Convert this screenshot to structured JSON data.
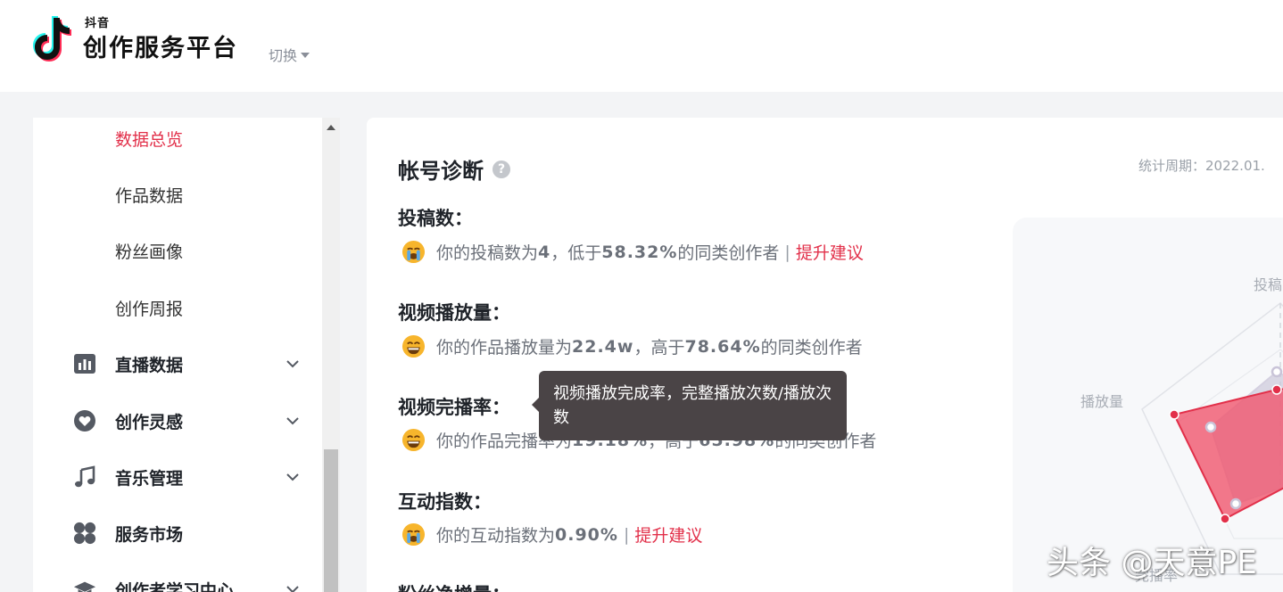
{
  "header": {
    "brand_small": "抖音",
    "brand_title": "创作服务平台",
    "switch_label": "切换"
  },
  "sidebar": {
    "sub_items": [
      {
        "label": "数据总览",
        "active": true
      },
      {
        "label": "作品数据",
        "active": false
      },
      {
        "label": "粉丝画像",
        "active": false
      },
      {
        "label": "创作周报",
        "active": false
      }
    ],
    "groups": [
      {
        "label": "直播数据",
        "icon": "bar-chart-icon",
        "expandable": true
      },
      {
        "label": "创作灵感",
        "icon": "heart-icon",
        "expandable": true
      },
      {
        "label": "音乐管理",
        "icon": "music-note-icon",
        "expandable": true
      },
      {
        "label": "服务市场",
        "icon": "grid-icon",
        "expandable": false
      },
      {
        "label": "创作者学习中心",
        "icon": "graduation-cap-icon",
        "expandable": true
      }
    ]
  },
  "main": {
    "title": "帐号诊断",
    "period": "统计周期：2022.01.",
    "metrics": [
      {
        "title": "投稿数：",
        "emoji": "crying-face-icon",
        "prefix": "你的投稿数为",
        "value": "4",
        "middle": "，低于",
        "percent": "58.32%",
        "suffix": "的同类创作者",
        "link": "提升建议"
      },
      {
        "title": "视频播放量：",
        "emoji": "grinning-face-icon",
        "prefix": "你的作品播放量为",
        "value": "22.4w",
        "middle": "，高于",
        "percent": "78.64%",
        "suffix": "的同类创作者",
        "link": ""
      },
      {
        "title": "视频完播率：",
        "emoji": "grinning-face-icon",
        "prefix": "你的作品完播率为",
        "value": "19.18%",
        "middle": "，高于",
        "percent": "65.98%",
        "suffix": "的同类创作者",
        "link": ""
      },
      {
        "title": "互动指数：",
        "emoji": "crying-face-icon",
        "prefix": "你的互动指数为",
        "value": "0.90%",
        "middle": "",
        "percent": "",
        "suffix": "",
        "link": "提升建议"
      },
      {
        "title": "粉丝净增量：",
        "emoji": "",
        "prefix": "",
        "value": "",
        "middle": "",
        "percent": "",
        "suffix": "",
        "link": ""
      }
    ],
    "radar_labels": {
      "top": "投稿",
      "left": "播放量",
      "bottom": "完播率"
    }
  },
  "tooltip": {
    "text": "视频播放完成率，完整播放次数/播放次数"
  },
  "watermark": "头条 @天意PE",
  "colors": {
    "accent": "#e2304a",
    "radar_fill": "#f0566e",
    "radar_compare": "#c9c4d8"
  }
}
